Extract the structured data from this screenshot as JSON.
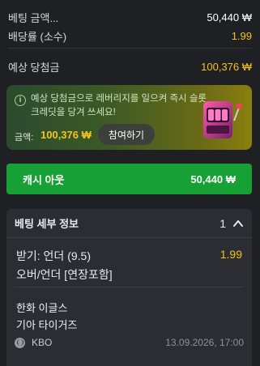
{
  "summary": {
    "stake_label": "베팅 금액...",
    "stake_value": "50,440 ₩",
    "odds_label": "배당률 (소수)",
    "odds_value": "1.99",
    "potential_label": "예상 당첨금",
    "potential_value": "100,376 ₩"
  },
  "promo": {
    "text": "예상 당첨금으로 레버리지를 일으켜 즉시 슬롯 크레딧을 당겨 쓰세요!",
    "amount_label": "금액:",
    "amount_value": "100,376 ₩",
    "join_label": "참여하기",
    "icon": "slot-machine-icon"
  },
  "cashout": {
    "label": "캐시 아웃",
    "value": "50,440 ₩",
    "color": "#17a035"
  },
  "details": {
    "title": "베팅 세부 정보",
    "count": "1",
    "selection": "받기: 언더 (9.5)",
    "market": "오버/언더 [연장포함]",
    "odds": "1.99",
    "home_team": "한화 이글스",
    "away_team": "기아 타이거즈",
    "league": "KBO",
    "datetime": "13.09.2026, 17:00"
  },
  "colors": {
    "background": "#1f2024",
    "accent_yellow": "#f5c518",
    "green": "#17a035"
  }
}
